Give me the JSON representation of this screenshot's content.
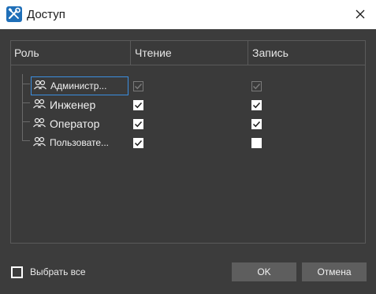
{
  "window": {
    "title": "Доступ",
    "app_icon": "tools-icon",
    "close_icon": "close-icon"
  },
  "table": {
    "columns": [
      "Роль",
      "Чтение",
      "Запись"
    ],
    "rows": [
      {
        "role": "Администр...",
        "read": true,
        "write": true,
        "disabled": true,
        "selected": true
      },
      {
        "role": "Инженер",
        "read": true,
        "write": true,
        "disabled": false,
        "selected": false
      },
      {
        "role": "Оператор",
        "read": true,
        "write": true,
        "disabled": false,
        "selected": false
      },
      {
        "role": "Пользовате...",
        "read": true,
        "write": false,
        "disabled": false,
        "selected": false
      }
    ]
  },
  "footer": {
    "select_all_label": "Выбрать все",
    "select_all_checked": false,
    "ok_label": "OK",
    "cancel_label": "Отмена"
  },
  "colors": {
    "dialog_bg": "#3c3c3c",
    "accent": "#3b8ee0",
    "button_bg": "#5e5e5e"
  }
}
